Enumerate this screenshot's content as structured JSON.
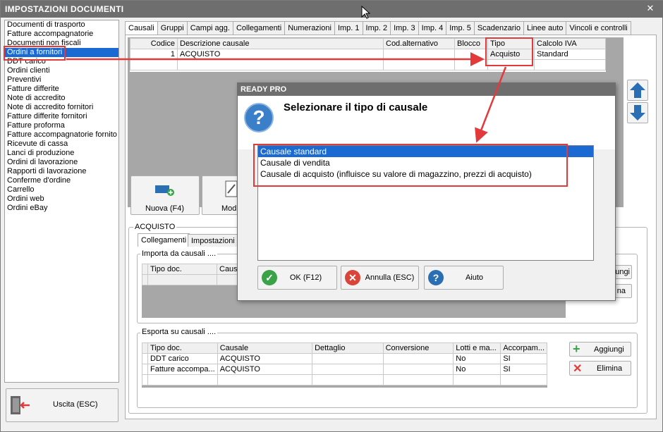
{
  "window": {
    "title": "IMPOSTAZIONI DOCUMENTI"
  },
  "doc_list": [
    "Documenti di trasporto",
    "Fatture accompagnatorie",
    "Documenti non fiscali",
    "Ordini a fornitori",
    "DDT carico",
    "Ordini clienti",
    "Preventivi",
    "Fatture differite",
    "Note di accredito",
    "Note di accredito fornitori",
    "Fatture differite fornitori",
    "Fatture proforma",
    "Fatture accompagnatorie fornito",
    "Ricevute di cassa",
    "Lanci di produzione",
    "Ordini di lavorazione",
    "Rapporti di lavorazione",
    "Conferme d'ordine",
    "Carrello",
    "Ordini web",
    "Ordini eBay"
  ],
  "exit_label": "Uscita (ESC)",
  "tabs": [
    "Causali",
    "Gruppi",
    "Campi agg.",
    "Collegamenti",
    "Numerazioni",
    "Imp. 1",
    "Imp. 2",
    "Imp. 3",
    "Imp. 4",
    "Imp. 5",
    "Scadenzario",
    "Linee auto",
    "Vincoli e controlli"
  ],
  "causali_table": {
    "headers": [
      "Codice",
      "Descrizione causale",
      "Cod.alternativo",
      "Blocco",
      "Tipo",
      "Calcolo IVA"
    ],
    "row": [
      "1",
      "ACQUISTO",
      "",
      "",
      "Acquisto",
      "Standard"
    ]
  },
  "buttons": {
    "nuova": "Nuova (F4)",
    "modifica": "Modi",
    "aggiungi": "Aggiungi",
    "elimina": "Elimina",
    "aggiungi_partial": "ungi",
    "elimina_partial": "na"
  },
  "section": {
    "title": "ACQUISTO",
    "subtabs": [
      "Collegamenti",
      "Impostazioni"
    ]
  },
  "importa": {
    "title": "Importa da causali ....",
    "headers": [
      "Tipo doc.",
      "Causa"
    ]
  },
  "esporta": {
    "title": "Esporta su causali ....",
    "headers": [
      "Tipo doc.",
      "Causale",
      "Dettaglio",
      "Conversione",
      "Lotti e ma...",
      "Accorpam..."
    ],
    "rows": [
      [
        "DDT carico",
        "ACQUISTO",
        "",
        "",
        "No",
        "SI"
      ],
      [
        "Fatture accompa...",
        "ACQUISTO",
        "",
        "",
        "No",
        "SI"
      ]
    ]
  },
  "dialog": {
    "title": "READY PRO",
    "question": "Selezionare il tipo di causale",
    "options": [
      "Causale standard",
      "Causale di vendita",
      "Causale di acquisto (influisce su valore di magazzino, prezzi di acquisto)"
    ],
    "ok": "OK (F12)",
    "annulla": "Annulla (ESC)",
    "aiuto": "Aiuto"
  },
  "colors": {
    "titlebar": "#6e6e6e",
    "selection": "#1b6ad3",
    "annotation": "#e23a3a"
  }
}
